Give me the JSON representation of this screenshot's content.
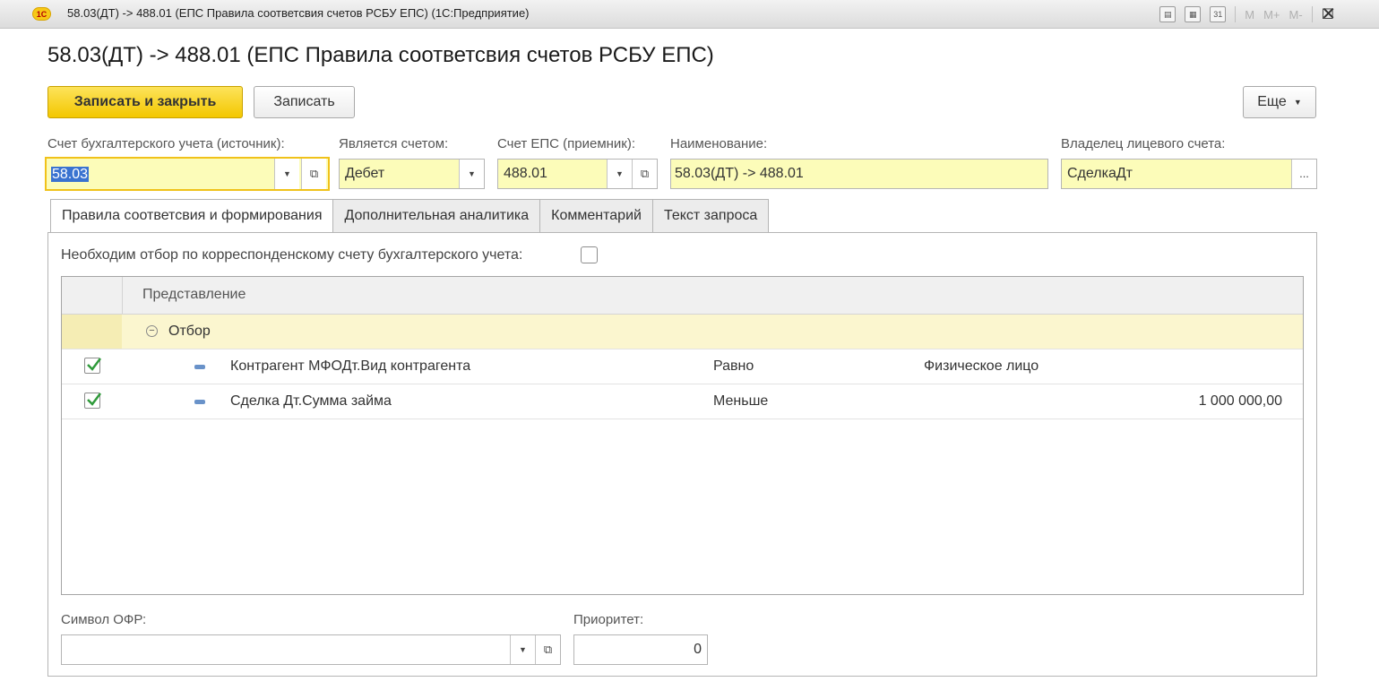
{
  "window": {
    "title": "58.03(ДТ) -> 488.01 (ЕПС Правила соответсвия счетов РСБУ ЕПС)  (1С:Предприятие)",
    "logo": "1С",
    "toolbar": {
      "m": "M",
      "m_plus": "M+",
      "m_minus": "M-",
      "calendar_day": "31"
    }
  },
  "page": {
    "title": "58.03(ДТ) -> 488.01 (ЕПС Правила соответсвия счетов РСБУ ЕПС)"
  },
  "actions": {
    "save_close": "Записать и закрыть",
    "save": "Записать",
    "more": "Еще"
  },
  "fields": {
    "source_account": {
      "label": "Счет бухгалтерского учета (источник):",
      "value": "58.03"
    },
    "is_account": {
      "label": "Является счетом:",
      "value": "Дебет"
    },
    "eps_account": {
      "label": "Счет ЕПС (приемник):",
      "value": "488.01"
    },
    "name": {
      "label": "Наименование:",
      "value": "58.03(ДТ) -> 488.01"
    },
    "owner": {
      "label": "Владелец лицевого счета:",
      "value": "СделкаДт",
      "button": "..."
    }
  },
  "tabs": [
    {
      "label": "Правила соответсвия и формирования",
      "active": true
    },
    {
      "label": "Дополнительная аналитика",
      "active": false
    },
    {
      "label": "Комментарий",
      "active": false
    },
    {
      "label": "Текст запроса",
      "active": false
    }
  ],
  "filter_checkbox": {
    "label": "Необходим отбор по корреспонденскому счету бухгалтерского учета:",
    "checked": false
  },
  "grid": {
    "column_header": "Представление",
    "group": {
      "label": "Отбор",
      "expanded": true
    },
    "rows": [
      {
        "checked": true,
        "field": "Контрагент МФОДт.Вид контрагента",
        "condition": "Равно",
        "value": "Физическое лицо"
      },
      {
        "checked": true,
        "field": "Сделка Дт.Сумма займа",
        "condition": "Меньше",
        "value": "1 000 000,00"
      }
    ]
  },
  "bottom": {
    "ofr_symbol": {
      "label": "Символ ОФР:",
      "value": ""
    },
    "priority": {
      "label": "Приоритет:",
      "value": "0"
    }
  },
  "colors": {
    "accent_yellow": "#f3c700",
    "field_yellow": "#fcfcb9",
    "selection": "#3a73d0"
  }
}
